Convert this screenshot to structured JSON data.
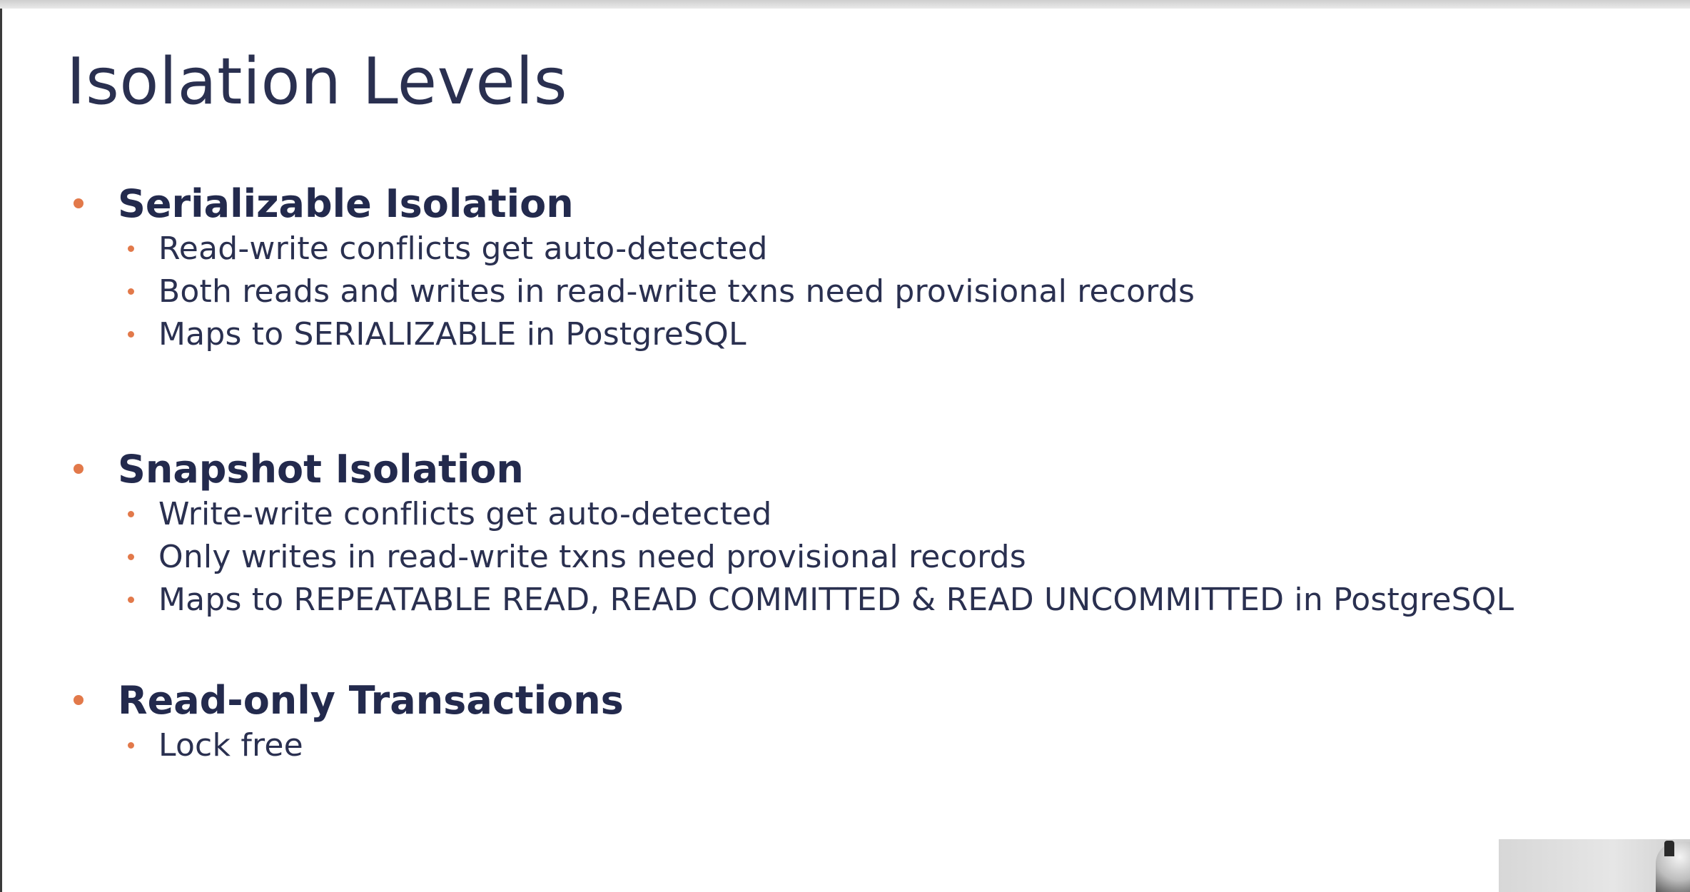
{
  "slide": {
    "title": "Isolation Levels",
    "sections": [
      {
        "heading": "Serializable Isolation",
        "items": [
          "Read-write conflicts get auto-detected",
          "Both reads and writes in read-write txns need provisional records",
          "Maps to SERIALIZABLE in PostgreSQL"
        ]
      },
      {
        "heading": "Snapshot Isolation",
        "items": [
          "Write-write conflicts get auto-detected",
          "Only writes in read-write txns need provisional records",
          "Maps to REPEATABLE READ, READ COMMITTED & READ UNCOMMITTED in PostgreSQL"
        ]
      },
      {
        "heading": "Read-only Transactions",
        "items": [
          "Lock free"
        ]
      }
    ]
  },
  "colors": {
    "title_text": "#2a3050",
    "heading_text": "#232a4d",
    "bullet": "#e2794a",
    "background": "#ffffff"
  }
}
